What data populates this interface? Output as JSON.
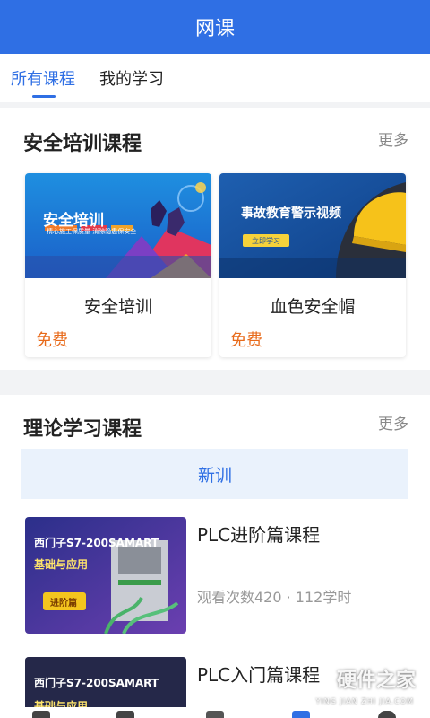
{
  "header": {
    "title": "网课"
  },
  "tabs": [
    {
      "label": "所有课程",
      "active": true
    },
    {
      "label": "我的学习",
      "active": false
    }
  ],
  "safety_section": {
    "title": "安全培训课程",
    "more": "更多",
    "cards": [
      {
        "name": "安全培训",
        "price": "免费",
        "banner_title": "安全培训",
        "banner_sub": "精心施工保质量 消除隐患保安全"
      },
      {
        "name": "血色安全帽",
        "price": "免费",
        "banner_title": "事故教育警示视频",
        "banner_button": "立即学习"
      }
    ]
  },
  "theory_section": {
    "title": "理论学习课程",
    "more": "更多",
    "category_tab": "新训",
    "courses": [
      {
        "title": "PLC进阶篇课程",
        "meta": "观看次数420 · 112学时",
        "thumb_title": "西门子S7-200SAMART",
        "thumb_sub": "基础与应用",
        "thumb_badge": "进阶篇"
      },
      {
        "title": "PLC入门篇课程",
        "thumb_title": "西门子S7-200SAMART",
        "thumb_sub": "基础与应用"
      }
    ]
  },
  "watermark": {
    "text": "硬件之家",
    "sub": "YING JIAN ZHI JIA.COM"
  },
  "colors": {
    "brand": "#2f6fe4",
    "price": "#e86a1a"
  }
}
